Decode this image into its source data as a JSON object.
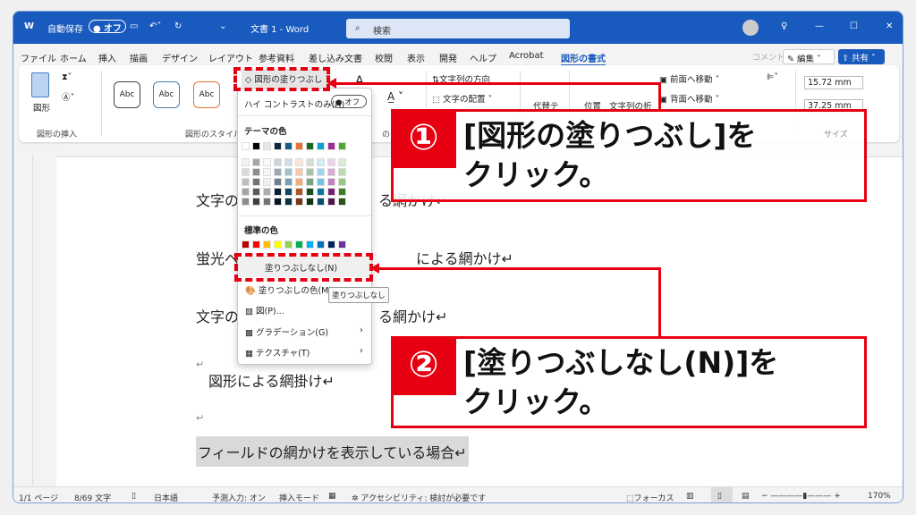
{
  "titlebar": {
    "autosave": "自動保存",
    "toggle": "オフ",
    "doc_title": "文書 1 - Word",
    "search": "検索"
  },
  "menubar": {
    "tabs": [
      "ファイル",
      "ホーム",
      "挿入",
      "描画",
      "デザイン",
      "レイアウト",
      "参考資料",
      "差し込み文書",
      "校閲",
      "表示",
      "開発",
      "ヘルプ",
      "Acrobat",
      "図形の書式"
    ],
    "active": "図形の書式",
    "comment": "コメント",
    "edit": "編集",
    "share": "共有"
  },
  "ribbon": {
    "shape": "図形",
    "insert_group": "図形の挿入",
    "style_sample": "Abc",
    "style_group": "図形のスタイル",
    "fill_button": "図形の塗りつぶし",
    "text_dir": "文字列の方向",
    "text_align": "文字の配置",
    "alt_text": "代替テ",
    "position": "位置",
    "wrap": "文字列の折",
    "front": "前面へ移動",
    "back": "背面へ移動",
    "height": "15.72 mm",
    "width": "37.25 mm",
    "size_group": "サイズ",
    "wordart_group": "のスタ"
  },
  "menu": {
    "high_contrast": "ハイ コントラストのみ(H)",
    "hc_toggle": "オフ",
    "theme_colors": "テーマの色",
    "standard_colors": "標準の色",
    "no_fill": "塗りつぶしなし(N)",
    "more_colors": "塗りつぶしの色(M)...",
    "picture": "図(P)...",
    "gradient": "グラデーション(G)",
    "texture": "テクスチャ(T)",
    "tooltip": "塗りつぶしなし",
    "theme_top": [
      "#ffffff",
      "#000000",
      "#e7e6e6",
      "#0e2841",
      "#156082",
      "#e97132",
      "#196b24",
      "#0f9ed5",
      "#a02b93",
      "#4ea72e"
    ],
    "standard": [
      "#c00000",
      "#ff0000",
      "#ffc000",
      "#ffff00",
      "#92d050",
      "#00b050",
      "#00b0f0",
      "#0070c0",
      "#002060",
      "#7030a0"
    ]
  },
  "document": {
    "line1a": "文字の",
    "line1b": "る網かけ↵",
    "line2a": "蛍光ペ",
    "line2b": "による網かけ↵",
    "line3a": "文字の",
    "line3b": "る網かけ↵",
    "para_mark": "↵",
    "shape_text": "図形による網掛け↵",
    "field_text": "フィールドの網かけを表示している場合↵"
  },
  "status": {
    "page": "1/1 ページ",
    "words": "8/69 文字",
    "lang": "日本語",
    "predict": "予測入力: オン",
    "insert": "挿入モード",
    "access": "アクセシビリティ: 検討が必要です",
    "focus": "フォーカス",
    "zoom": "170%"
  },
  "callouts": {
    "c1_num": "①",
    "c1_l1": "[図形の塗りつぶし]を",
    "c1_l2": "クリック。",
    "c2_num": "②",
    "c2_l1": "[塗りつぶしなし(N)]を",
    "c2_l2": "クリック。"
  },
  "colors": {
    "accent": "#185abd",
    "callout": "#e60012"
  }
}
